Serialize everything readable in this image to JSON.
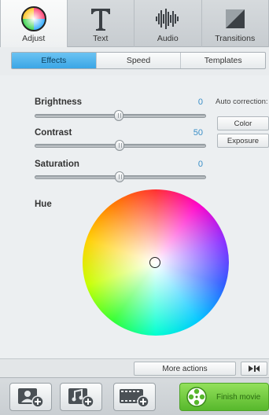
{
  "tabs": [
    {
      "label": "Adjust",
      "icon": "color-circle-icon"
    },
    {
      "label": "Text",
      "icon": "text-t-icon"
    },
    {
      "label": "Audio",
      "icon": "audio-waveform-icon"
    },
    {
      "label": "Transitions",
      "icon": "transition-icon"
    }
  ],
  "subtabs": [
    "Effects",
    "Speed",
    "Templates"
  ],
  "adjust": {
    "brightness": {
      "label": "Brightness",
      "value": "0"
    },
    "contrast": {
      "label": "Contrast",
      "value": "50"
    },
    "saturation": {
      "label": "Saturation",
      "value": "0"
    },
    "hue": {
      "label": "Hue"
    }
  },
  "auto_correction": {
    "label": "Auto correction:",
    "color_button": "Color",
    "exposure_button": "Exposure"
  },
  "actions": {
    "more_actions": "More actions",
    "collapse_icon": "panel-toggle-icon"
  },
  "toolbar": {
    "add_image_icon": "add-image-icon",
    "add_music_icon": "add-music-icon",
    "add_video_icon": "add-video-icon",
    "finish_label": "Finish movie",
    "finish_icon": "film-reel-icon"
  },
  "colors": {
    "accent_blue": "#3aa6e6",
    "value_blue": "#3a8fc8",
    "finish_green": "#57b82c"
  }
}
